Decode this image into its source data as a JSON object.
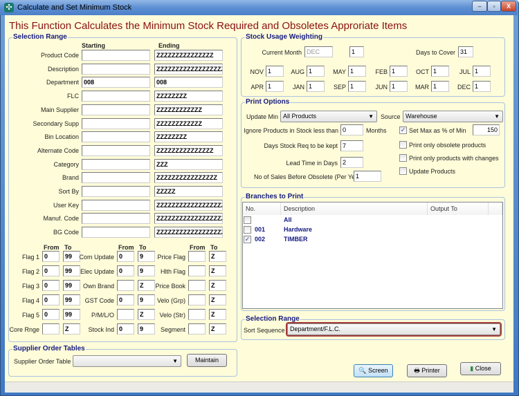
{
  "window": {
    "title": "Calculate and Set Minimum Stock",
    "heading": "This Function Calculates the Minimum Stock Required and Obsoletes Approriate Items"
  },
  "selection_range": {
    "title": "Selection Range",
    "starting_label": "Starting",
    "ending_label": "Ending",
    "rows": [
      {
        "label": "Product Code",
        "start": "",
        "end": "ZZZZZZZZZZZZZZZ"
      },
      {
        "label": "Description",
        "start": "",
        "end": "ZZZZZZZZZZZZZZZZZZZZ"
      },
      {
        "label": "Department",
        "start": "008",
        "end": "008"
      },
      {
        "label": "FLC",
        "start": "",
        "end": "ZZZZZZZZ"
      },
      {
        "label": "Main Supplier",
        "start": "",
        "end": "ZZZZZZZZZZZZ"
      },
      {
        "label": "Secondary Supp",
        "start": "",
        "end": "ZZZZZZZZZZZZ"
      },
      {
        "label": "Bin Location",
        "start": "",
        "end": "ZZZZZZZZ"
      },
      {
        "label": "Alternate Code",
        "start": "",
        "end": "ZZZZZZZZZZZZZZZ"
      },
      {
        "label": "Category",
        "start": "",
        "end": "ZZZ"
      },
      {
        "label": "Brand",
        "start": "",
        "end": "ZZZZZZZZZZZZZZZZ"
      },
      {
        "label": "Sort By",
        "start": "",
        "end": "ZZZZZ"
      },
      {
        "label": "User Key",
        "start": "",
        "end": "ZZZZZZZZZZZZZZZZZZZZ"
      },
      {
        "label": "Manuf. Code",
        "start": "",
        "end": "ZZZZZZZZZZZZZZZZZZZZ"
      },
      {
        "label": "BG Code",
        "start": "",
        "end": "ZZZZZZZZZZZZZZZZZZZZ"
      }
    ],
    "from_label": "From",
    "to_label": "To",
    "flag_columns": [
      [
        {
          "label": "Flag 1",
          "from": "0",
          "to": "99"
        },
        {
          "label": "Flag 2",
          "from": "0",
          "to": "99"
        },
        {
          "label": "Flag 3",
          "from": "0",
          "to": "99"
        },
        {
          "label": "Flag 4",
          "from": "0",
          "to": "99"
        },
        {
          "label": "Flag 5",
          "from": "0",
          "to": "99"
        },
        {
          "label": "Core Rnge",
          "from": "",
          "to": "Z"
        }
      ],
      [
        {
          "label": "Com Update",
          "from": "0",
          "to": "9"
        },
        {
          "label": "Elec Update",
          "from": "0",
          "to": "9"
        },
        {
          "label": "Own Brand",
          "from": "",
          "to": "Z"
        },
        {
          "label": "GST Code",
          "from": "0",
          "to": "9"
        },
        {
          "label": "P/M/L/O",
          "from": "",
          "to": "Z"
        },
        {
          "label": "Stock Ind",
          "from": "0",
          "to": "9"
        }
      ],
      [
        {
          "label": "Price Flag",
          "from": "",
          "to": "Z"
        },
        {
          "label": "Hlth Flag",
          "from": "",
          "to": "Z"
        },
        {
          "label": "Price Book",
          "from": "",
          "to": "Z"
        },
        {
          "label": "Velo (Grp)",
          "from": "",
          "to": "Z"
        },
        {
          "label": "Velo (Str)",
          "from": "",
          "to": "Z"
        },
        {
          "label": "Segment",
          "from": "",
          "to": "Z"
        }
      ]
    ]
  },
  "supplier_order": {
    "title": "Supplier Order Tables",
    "label": "Supplier Order Table",
    "value": "",
    "maintain": "Maintain"
  },
  "stock_usage": {
    "title": "Stock Usage Weighting",
    "current_month_label": "Current Month",
    "current_month": "DEC",
    "current_weight": "1",
    "days_to_cover_label": "Days to Cover",
    "days_to_cover": "31",
    "months": [
      [
        {
          "m": "NOV",
          "v": "1"
        },
        {
          "m": "AUG",
          "v": "1"
        },
        {
          "m": "MAY",
          "v": "1"
        },
        {
          "m": "FEB",
          "v": "1"
        },
        {
          "m": "OCT",
          "v": "1"
        },
        {
          "m": "JUL",
          "v": "1"
        }
      ],
      [
        {
          "m": "APR",
          "v": "1"
        },
        {
          "m": "JAN",
          "v": "1"
        },
        {
          "m": "SEP",
          "v": "1"
        },
        {
          "m": "JUN",
          "v": "1"
        },
        {
          "m": "MAR",
          "v": "1"
        },
        {
          "m": "DEC",
          "v": "1"
        }
      ]
    ]
  },
  "print_options": {
    "title": "Print Options",
    "update_min_label": "Update Min",
    "update_min": "All Products",
    "source_label": "Source",
    "source": "Warehouse",
    "ignore_label": "Ignore Products in Stock less than",
    "ignore_value": "0",
    "months_label": "Months",
    "days_req_label": "Days Stock Req to be kept",
    "days_req": "7",
    "lead_label": "Lead Time in Days",
    "lead": "2",
    "sales_label": "No of Sales Before Obsolete (Per Year)",
    "sales": "1",
    "set_max_label": "Set Max as % of Min",
    "set_max_checked": true,
    "set_max_value": "150",
    "obsolete_label": "Print only obsolete products",
    "obsolete_checked": false,
    "changes_label": "Print only products with changes",
    "changes_checked": false,
    "update_label": "Update Products",
    "update_checked": false
  },
  "branches": {
    "title": "Branches to Print",
    "columns": [
      "No.",
      "Description",
      "Output To"
    ],
    "rows": [
      {
        "no": "",
        "desc": "All",
        "checked": false
      },
      {
        "no": "001",
        "desc": "Hardware",
        "checked": false
      },
      {
        "no": "002",
        "desc": "TIMBER",
        "checked": true
      }
    ]
  },
  "sort": {
    "title": "Selection Range",
    "label": "Sort Sequence",
    "value": "Department/F.L.C.",
    "highlight": "#a33b3b"
  },
  "buttons": {
    "screen": "Screen",
    "printer": "Printer",
    "close": "Close"
  },
  "colors": {
    "heading": "#8b1010",
    "group_title": "#151a80",
    "background": "#fefcd9"
  }
}
